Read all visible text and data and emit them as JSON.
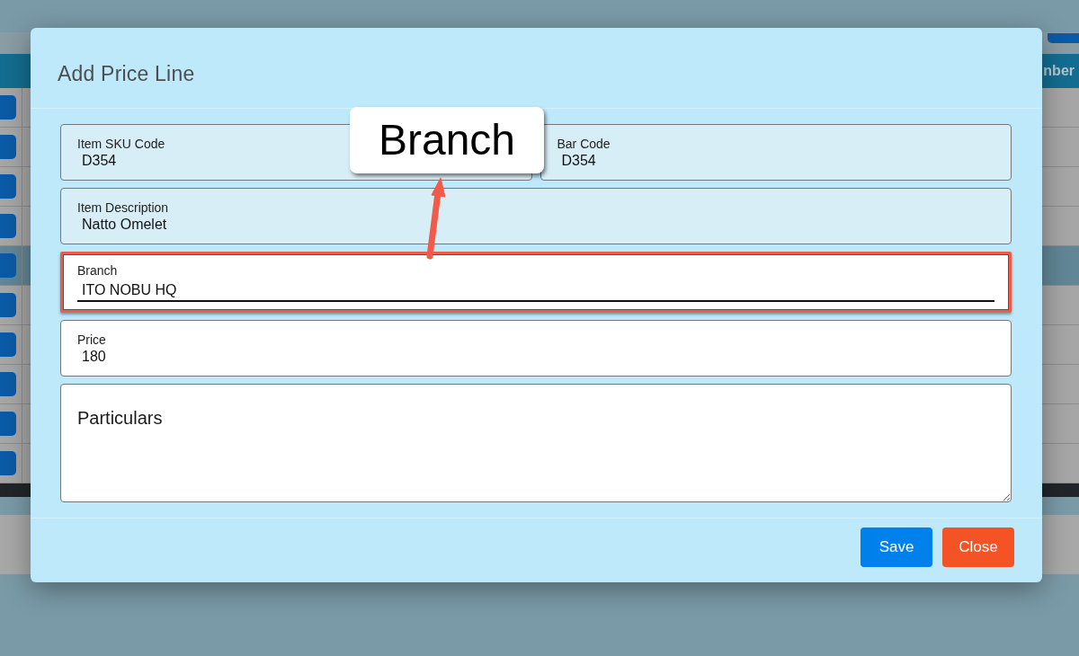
{
  "background_app": {
    "table": {
      "header_fragment": "nber",
      "rows": [
        {
          "selected": false
        },
        {
          "selected": false
        },
        {
          "selected": false
        },
        {
          "selected": false
        },
        {
          "selected": true
        },
        {
          "selected": false
        },
        {
          "selected": false
        },
        {
          "selected": false
        },
        {
          "selected": false
        },
        {
          "selected": false
        }
      ]
    }
  },
  "dialog": {
    "title": "Add Price Line",
    "field_rows": [
      {
        "fields": [
          {
            "kind": "text",
            "label": "Item SKU Code",
            "value": "D354",
            "readonly": true,
            "focused": false,
            "highlighted": false
          },
          {
            "kind": "text",
            "label": "Bar Code",
            "value": "D354",
            "readonly": true,
            "focused": false,
            "highlighted": false
          }
        ]
      },
      {
        "fields": [
          {
            "kind": "text",
            "label": "Item Description",
            "value": "Natto Omelet",
            "readonly": true,
            "focused": false,
            "highlighted": false
          }
        ]
      },
      {
        "fields": [
          {
            "kind": "text",
            "label": "Branch",
            "value": "ITO NOBU HQ",
            "readonly": false,
            "focused": true,
            "highlighted": true
          }
        ]
      },
      {
        "fields": [
          {
            "kind": "text",
            "label": "Price",
            "value": "180",
            "readonly": false,
            "focused": false,
            "highlighted": false
          }
        ]
      },
      {
        "fields": [
          {
            "kind": "textarea",
            "placeholder": "Particulars",
            "readonly": false,
            "focused": false,
            "highlighted": false
          }
        ]
      }
    ],
    "buttons": [
      {
        "label": "Save",
        "kind": "primary"
      },
      {
        "label": "Close",
        "kind": "danger"
      }
    ]
  },
  "annotation": {
    "callout": "Branch"
  }
}
